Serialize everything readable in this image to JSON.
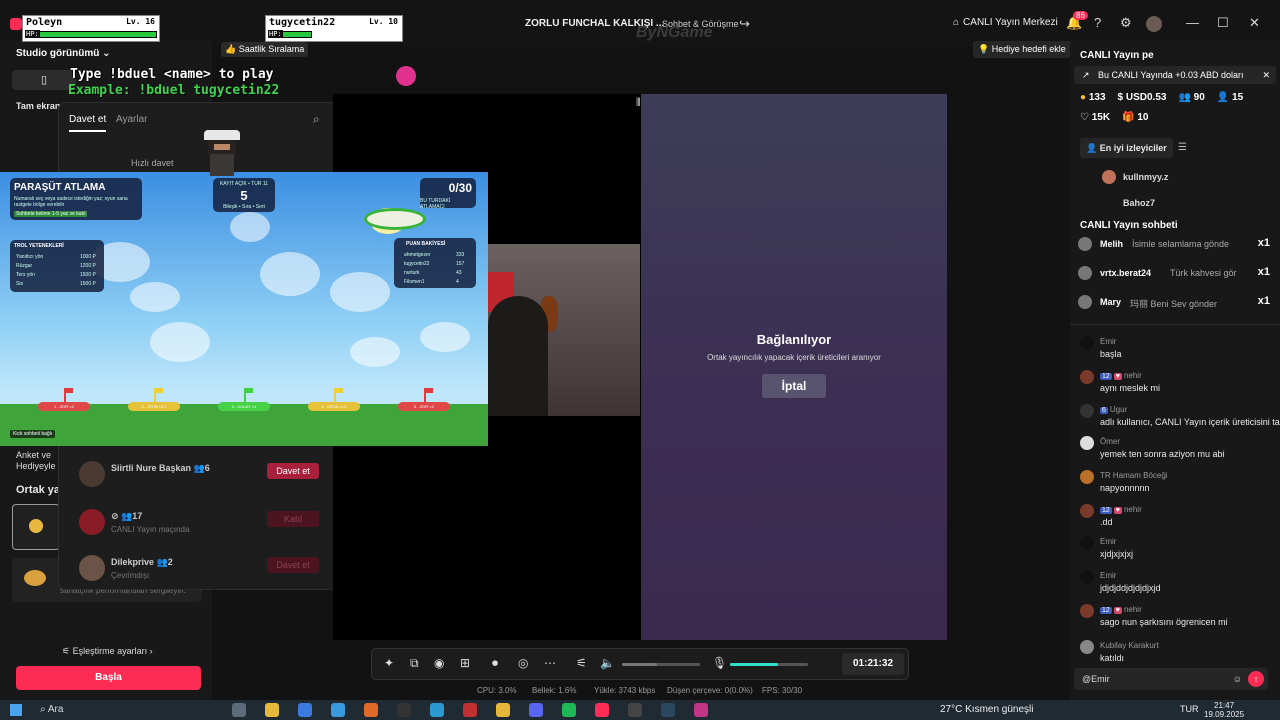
{
  "window": {
    "title": "ZORLU FUNCHAL KALKIŞI ...",
    "tab_chat": "Sohbet & Görüşme",
    "brand": "ByNGame",
    "live_center": "CANLI Yayın Merkezi",
    "notif_count": "86"
  },
  "left": {
    "studio_view": "Studio görünümü",
    "fullscreen": "Tam ekran",
    "poll": "Anket ve Hediyeyle",
    "ortak": "Ortak yay",
    "thumb_text": "sanatçılık performansları sergileyin.",
    "match_settings": "Eşleştirme ayarları",
    "start": "Başla"
  },
  "invite": {
    "tab_invite": "Davet et",
    "tab_settings": "Ayarlar",
    "quick_invite": "Hızlı davet",
    "rows": [
      {
        "name": "Siirtli Nure Başkan",
        "count": "6",
        "status": "",
        "action": "Davet et"
      },
      {
        "name": "",
        "count": "17",
        "status": "CANLI Yayın maçında",
        "action": "Katıl"
      },
      {
        "name": "Dilekprive",
        "count": "2",
        "status": "Çevrimdışı",
        "action": "Davet et"
      }
    ]
  },
  "overlay": {
    "player1": {
      "name": "Poleyn",
      "level": "Lv. 16",
      "hp_label": "HP:",
      "hp": 1.0
    },
    "player2": {
      "name": "tugycetin22",
      "level": "Lv. 10",
      "hp_label": "HP:",
      "hp": 0.25
    },
    "type_to_play": "Type !bduel <name> to play",
    "example": "Example: !bduel tugycetin22",
    "ranking": "Saatlik Sıralama"
  },
  "game": {
    "title": "PARAŞÜT ATLAMA",
    "subtitle": "Numaralı seç veya sadece istediğin yaz; oyun sana rastgele bölge verebilir",
    "hint": "Sohbete kelime 1-5 yaz ve katıl",
    "round_label": "KAYIT AÇIK • TUR 11",
    "round_value": "5",
    "round_sub": "Bileşik • Sıra • Sert",
    "counter": "0/30",
    "counter_sub": "BU TURDAKİ ATLAMACI",
    "troll_title": "TROL YETENEKLERİ",
    "troll_rows": [
      {
        "name": "Yanıltıcı yön",
        "cost": "1000 P"
      },
      {
        "name": "Rüzgar",
        "cost": "1200 P"
      },
      {
        "name": "Ters yön",
        "cost": "1500 P"
      },
      {
        "name": "Sis",
        "cost": "1500 P"
      }
    ],
    "score_title": "PUAN BAKİYESİ",
    "score_rows": [
      {
        "name": "ahmetgezer",
        "pts": "333"
      },
      {
        "name": "tugycetin22",
        "pts": "157"
      },
      {
        "name": "nurturk",
        "pts": "43"
      },
      {
        "name": "Filomen1",
        "pts": "4"
      }
    ],
    "zones": [
      "1 - ZOR ×2",
      "2 - ORTA ×1.2",
      "3 - KOLAY ×1",
      "4 - ORTA ×1.2",
      "5 - ZOR ×2"
    ],
    "footer": "Kick sohbeti bağlı"
  },
  "stage": {
    "connect_title": "Bağlanılıyor",
    "connect_sub": "Ortak yayıncılık yapacak içerik üreticileri aranıyor",
    "cancel": "İptal"
  },
  "gift_goal": "Hediye hedefi ekle",
  "controls": {
    "timer": "01:21:32",
    "volume": 0.45,
    "mic_level": 0.62
  },
  "stats": {
    "cpu": "CPU: 3.0%",
    "memory": "Bellek: 1.6%",
    "upload": "Yükle: 3743 kbps",
    "dropped": "Düşen çerçeve: 0(0.0%)",
    "fps": "FPS: 30/30"
  },
  "right": {
    "title": "CANLI Yayın pe",
    "banner": "Bu CANLI Yayında +0.03 ABD doları",
    "stats": {
      "coins": "133",
      "usd": "USD0.53",
      "viewers": "90",
      "followers": "15",
      "likes": "15K",
      "gifts": "10"
    },
    "top_viewers_btn": "En iyi izleyiciler",
    "viewers": [
      "kullnmyy.z",
      "Bahoz7"
    ],
    "chat_title": "CANLI Yayın sohbeti",
    "gifts": [
      {
        "name": "Melih",
        "msg": "İsimle selamlama gönde",
        "count": "x1"
      },
      {
        "name": "vrtx.berat24",
        "msg": "Türk kahvesi gör",
        "count": "x1"
      },
      {
        "name": "Mary",
        "msg": "玛丽 Beni Sev gönder",
        "count": "x1"
      }
    ],
    "messages": [
      {
        "user": "Emir",
        "tags": [],
        "text": "başla"
      },
      {
        "user": "nehir",
        "tags": [
          "12",
          "♥"
        ],
        "text": "aynı meslek mi"
      },
      {
        "user": "Ugur",
        "tags": [
          "6"
        ],
        "text": "adlı kullanıcı, CANLI Yayın içerik üreticisini takip etti"
      },
      {
        "user": "Ömer",
        "tags": [],
        "text": "yemek ten sonra aziyon mu abi"
      },
      {
        "user": "TR Hamam Böceği",
        "tags": [],
        "text": "napyonnnnn"
      },
      {
        "user": "nehir",
        "tags": [
          "12",
          "♥"
        ],
        "text": ".dd"
      },
      {
        "user": "Emir",
        "tags": [],
        "text": "xjdjxjxjxj"
      },
      {
        "user": "Emir",
        "tags": [],
        "text": "jdjdjddjdjdjdjxjd"
      },
      {
        "user": "nehir",
        "tags": [
          "12",
          "♥"
        ],
        "text": "sago nun şarkısını ögrenicen mi"
      },
      {
        "user": "Kubilay Karakurt",
        "tags": [],
        "text": "katıldı"
      }
    ],
    "input": "@Emir"
  },
  "taskbar": {
    "search": "Ara",
    "weather": "27°C  Kısmen güneşli",
    "lang": "TUR",
    "time": "21:47",
    "date": "19.09.2025"
  },
  "colors": {
    "accent": "#fe2c55",
    "hp_green": "#28c940",
    "mic": "#2ee0c8"
  }
}
